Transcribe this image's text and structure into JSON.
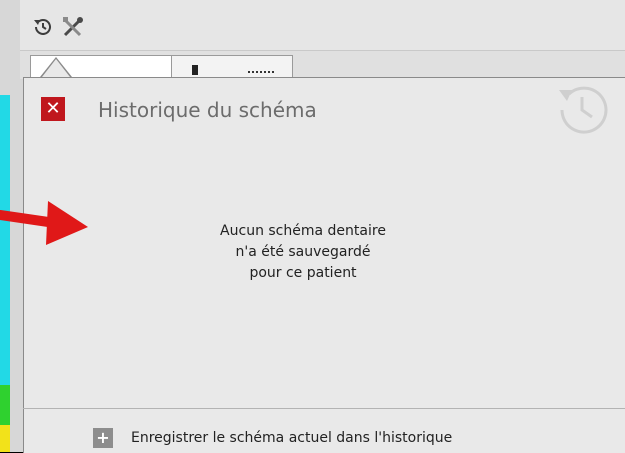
{
  "toolbar": {
    "icons": [
      "history-icon",
      "tools-icon"
    ]
  },
  "popover": {
    "title": "Historique du schéma",
    "empty_message": {
      "line1": "Aucun schéma dentaire",
      "line2": "n'a été sauvegardé",
      "line3": "pour ce patient"
    },
    "save_button_label": "Enregistrer le schéma actuel dans l'historique"
  },
  "colors": {
    "close_red": "#c0171d",
    "annotation_arrow": "#e01818",
    "popover_bg": "#e9e9e9"
  }
}
